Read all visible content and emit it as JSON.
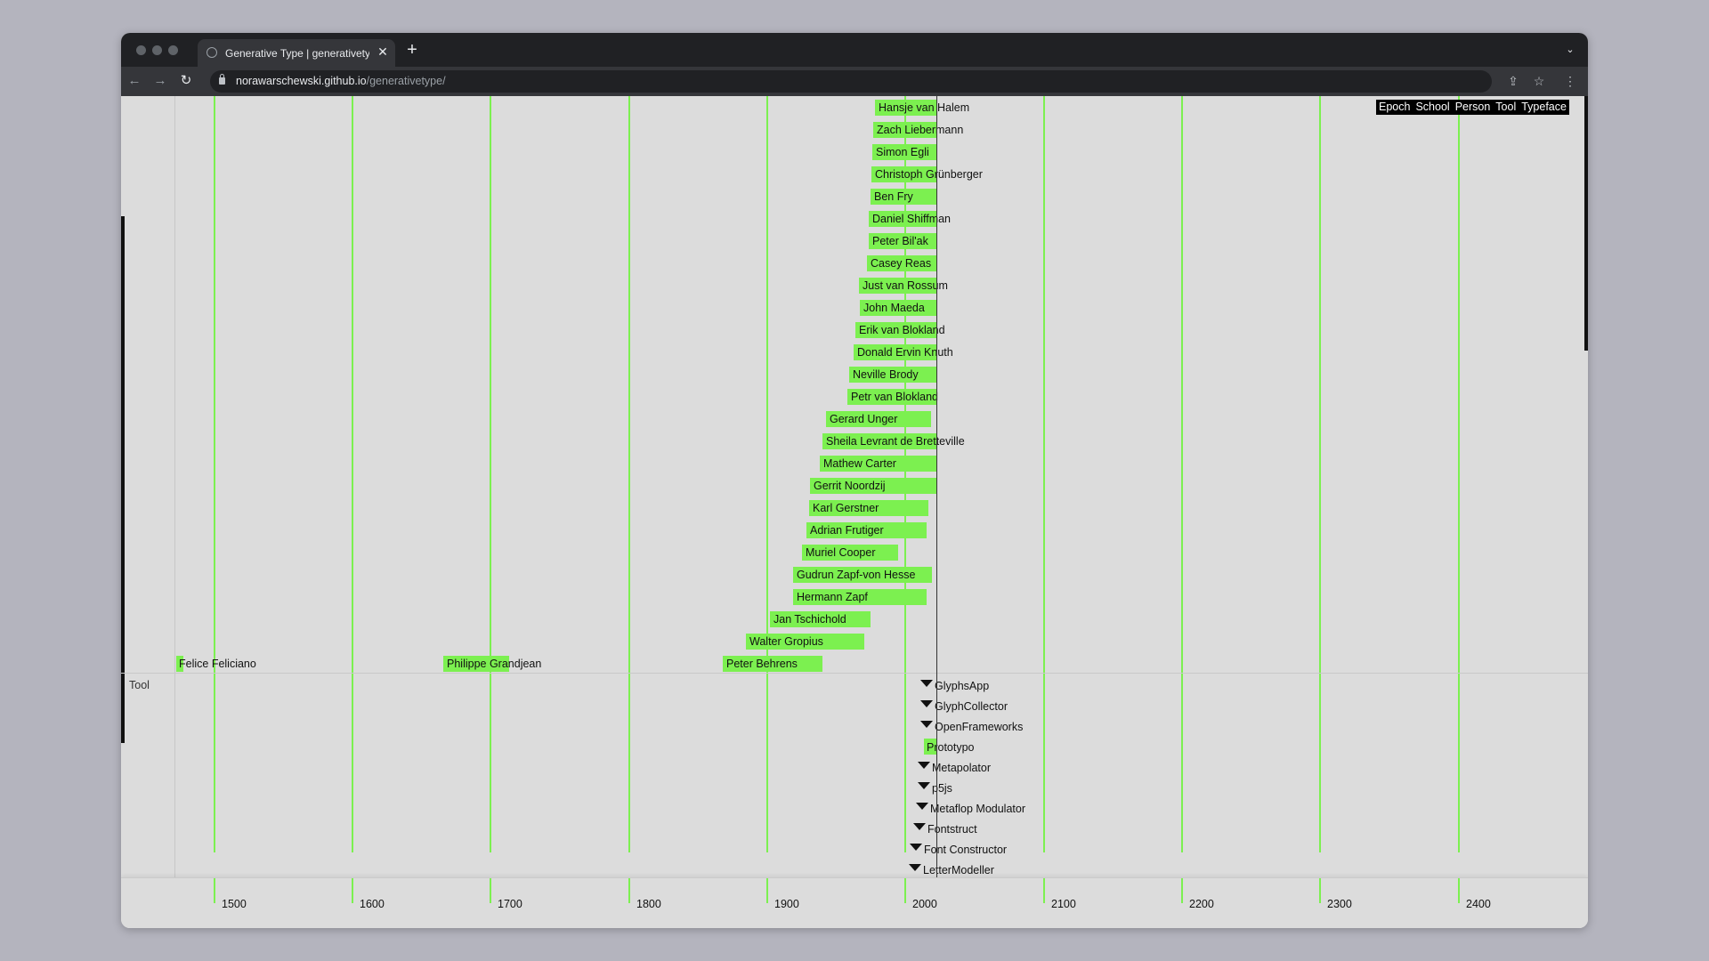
{
  "browser": {
    "tab_title": "Generative Type | generativetype",
    "tab_close": "✕",
    "new_tab": "+",
    "tab_menu": "⌄",
    "url_host": "norawarschewski.github.io",
    "url_path": "/generativetype/",
    "icons": [
      "back-icon",
      "forward-icon",
      "reload-icon",
      "lock-icon",
      "share-icon",
      "star-icon",
      "kebab-menu-icon",
      "globe-icon"
    ]
  },
  "filters": [
    "Epoch",
    "School",
    "Person",
    "Tool",
    "Typeface"
  ],
  "section": {
    "label": "Tool"
  },
  "axis": {
    "years": [
      "1500",
      "1600",
      "1700",
      "1800",
      "1900",
      "2000",
      "2100",
      "2200",
      "2300",
      "2400"
    ]
  },
  "persons": [
    {
      "name": "Hansje van Halem"
    },
    {
      "name": "Zach Liebermann"
    },
    {
      "name": "Simon Egli"
    },
    {
      "name": "Christoph Grünberger"
    },
    {
      "name": "Ben Fry"
    },
    {
      "name": "Daniel Shiffman"
    },
    {
      "name": "Peter Bil'ak"
    },
    {
      "name": "Casey Reas"
    },
    {
      "name": "Just van Rossum"
    },
    {
      "name": "John Maeda"
    },
    {
      "name": "Erik van Blokland"
    },
    {
      "name": "Donald Ervin Knuth"
    },
    {
      "name": "Neville Brody"
    },
    {
      "name": "Petr van Blokland"
    },
    {
      "name": "Gerard Unger"
    },
    {
      "name": "Sheila Levrant de Bretteville"
    },
    {
      "name": "Mathew Carter"
    },
    {
      "name": "Gerrit Noordzij"
    },
    {
      "name": "Karl Gerstner"
    },
    {
      "name": "Adrian Frutiger"
    },
    {
      "name": "Muriel Cooper"
    },
    {
      "name": "Gudrun Zapf-von Hesse"
    },
    {
      "name": "Hermann Zapf"
    },
    {
      "name": "Jan Tschichold"
    },
    {
      "name": "Walter Gropius"
    },
    {
      "name": "Felice Feliciano"
    },
    {
      "name": "Philippe Grandjean"
    },
    {
      "name": "Peter Behrens"
    }
  ],
  "tools": [
    {
      "name": "GlyphsApp"
    },
    {
      "name": "GlyphCollector"
    },
    {
      "name": "OpenFrameworks"
    },
    {
      "name": "Prototypo"
    },
    {
      "name": "Metapolator"
    },
    {
      "name": "p5js"
    },
    {
      "name": "Metaflop Modulator"
    },
    {
      "name": "Fontstruct"
    },
    {
      "name": "Font Constructor"
    },
    {
      "name": "LetterModeller"
    }
  ],
  "colors": {
    "accent": "#7cf050",
    "background": "#dcdcdc",
    "text": "#111111",
    "filter_bg": "#000000"
  }
}
